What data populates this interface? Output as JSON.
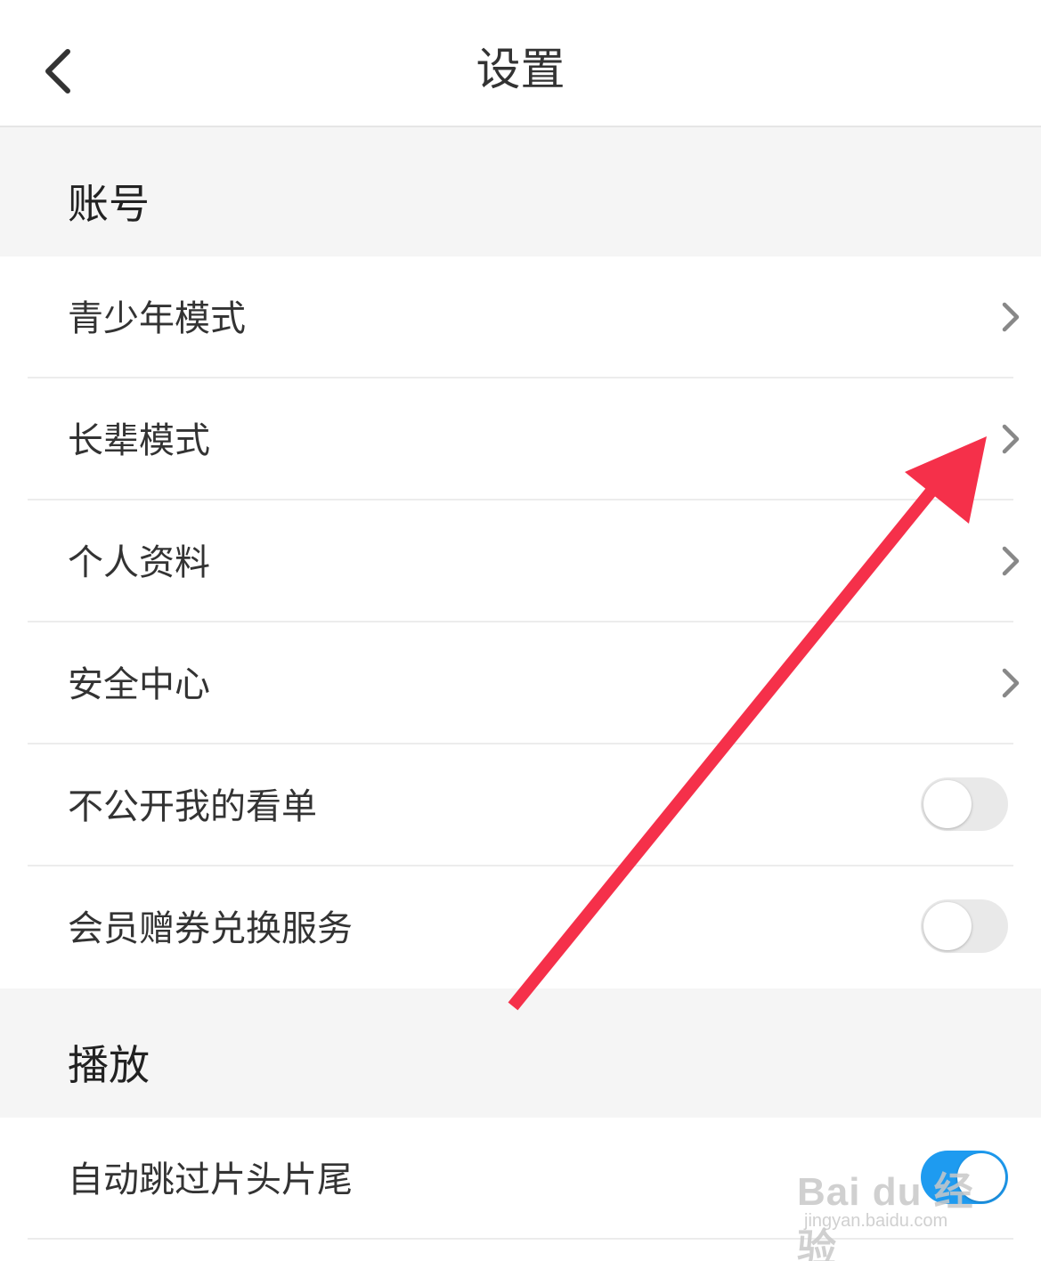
{
  "header": {
    "title": "设置"
  },
  "sections": [
    {
      "title": "账号",
      "rows": [
        {
          "label": "青少年模式",
          "control": "chevron"
        },
        {
          "label": "长辈模式",
          "control": "chevron"
        },
        {
          "label": "个人资料",
          "control": "chevron"
        },
        {
          "label": "安全中心",
          "control": "chevron"
        },
        {
          "label": "不公开我的看单",
          "control": "toggle",
          "on": false
        },
        {
          "label": "会员赠券兑换服务",
          "control": "toggle",
          "on": false
        }
      ]
    },
    {
      "title": "播放",
      "rows": [
        {
          "label": "自动跳过片头片尾",
          "control": "toggle",
          "on": true
        }
      ]
    }
  ],
  "watermark": {
    "main": "Bai du 经验",
    "sub": "jingyan.baidu.com"
  },
  "colors": {
    "accent": "#1e9bf0",
    "arrow": "#f5304a",
    "section_bg": "#f5f5f5"
  },
  "icons": {
    "back": "chevron-left-icon",
    "row": "chevron-right-icon",
    "annotation": "red-arrow-icon"
  }
}
